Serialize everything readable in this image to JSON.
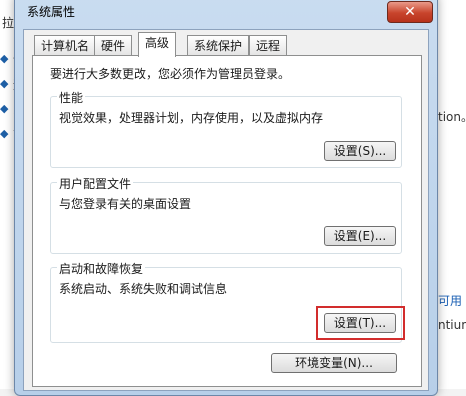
{
  "background": {
    "fragments": [
      "拉",
      "设",
      "远",
      "系",
      "高",
      "tion。",
      "可用",
      "ntium"
    ]
  },
  "window": {
    "title": "系统属性",
    "close_glyph": "✕",
    "tabs": [
      "计算机名",
      "硬件",
      "高级",
      "系统保护",
      "远程"
    ],
    "active_tab": "高级"
  },
  "advanced": {
    "admin_note": "要进行大多数更改，您必须作为管理员登录。",
    "performance": {
      "label": "性能",
      "description": "视觉效果，处理器计划，内存使用，以及虚拟内存",
      "button": "设置(S)..."
    },
    "profiles": {
      "label": "用户配置文件",
      "description": "与您登录有关的桌面设置",
      "button": "设置(E)..."
    },
    "startup": {
      "label": "启动和故障恢复",
      "description": "系统启动、系统失败和调试信息",
      "button": "设置(T)..."
    },
    "env_button": "环境变量(N)..."
  },
  "colors": {
    "highlight": "#d22d2d",
    "close_button": "#c8442c"
  }
}
